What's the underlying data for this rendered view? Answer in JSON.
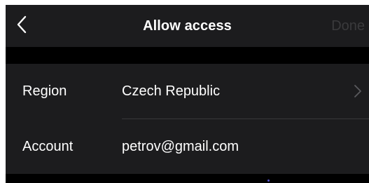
{
  "navbar": {
    "title": "Allow access",
    "back_icon": "chevron-left-icon",
    "done_label": "Done"
  },
  "form": {
    "rows": [
      {
        "label": "Region",
        "value": "Czech Republic",
        "chevron_icon": "chevron-right-icon"
      },
      {
        "label": "Account",
        "value": "petrov@gmail.com"
      }
    ]
  },
  "colors": {
    "background": "#000000",
    "surface": "#1c1c1e",
    "text": "#ffffff",
    "disabled_text": "#3a3a3c",
    "separator": "#38383a",
    "chevron": "#5a5a5e"
  }
}
